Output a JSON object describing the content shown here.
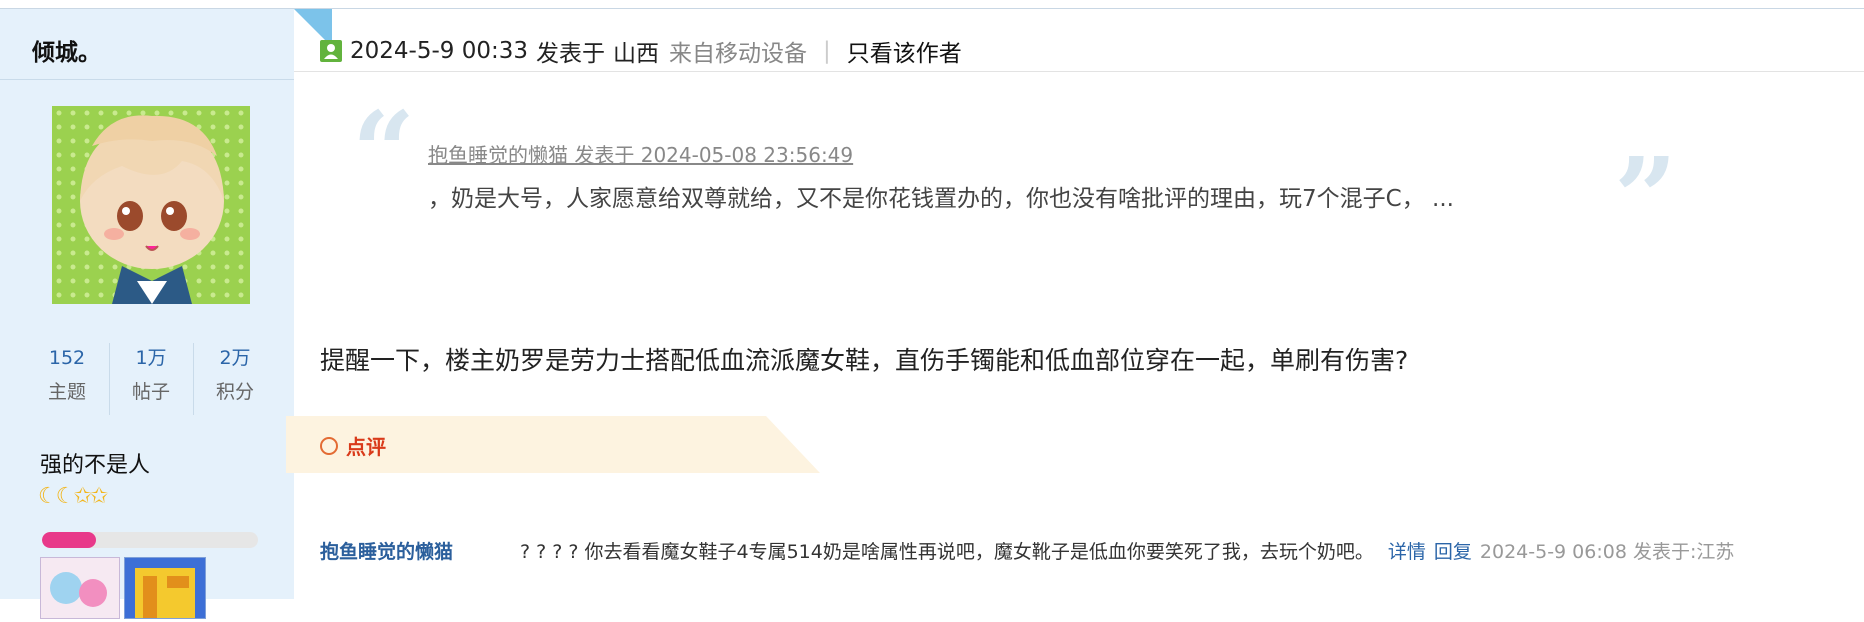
{
  "author": {
    "name": "倾城。",
    "stats": [
      {
        "value": "152",
        "label": "主题"
      },
      {
        "value": "1万",
        "label": "帖子"
      },
      {
        "value": "2万",
        "label": "积分"
      }
    ],
    "rank_title": "强的不是人",
    "stars_icons": [
      "moon-icon",
      "moon-icon",
      "star-icon",
      "star-icon"
    ],
    "stars_text": "☾☾✩✩",
    "level_progress": 0.25
  },
  "post": {
    "datetime": "2024-5-9 00:33",
    "posted_at": "发表于",
    "location": "山西",
    "source": "来自移动设备",
    "separator": "|",
    "author_only": "只看该作者",
    "quote": {
      "meta": "抱鱼睡觉的懒猫 发表于 2024-05-08 23:56:49",
      "text": "，奶是大号，人家愿意给双尊就给，又不是你花钱置办的，你也没有啥批评的理由，玩7个混子C， ..."
    },
    "body": "提醒一下，楼主奶罗是劳力士搭配低血流派魔女鞋，直伤手镯能和低血部位穿在一起，单刷有伤害?"
  },
  "review": {
    "label": "点评",
    "comment": {
      "user": "抱鱼睡觉的懒猫",
      "text": "? ? ? ? 你去看看魔女鞋子4专属514奶是啥属性再说吧，魔女靴子是低血你要笑死了我，去玩个奶吧。",
      "details_label": "详情",
      "reply_label": "回复",
      "meta": "2024-5-9 06:08 发表于:江苏"
    }
  },
  "colors": {
    "sidebar_bg": "#e5f1fb",
    "link_blue": "#2b65a8",
    "review_red": "#d93a1a",
    "progress_pink": "#e8398a"
  }
}
